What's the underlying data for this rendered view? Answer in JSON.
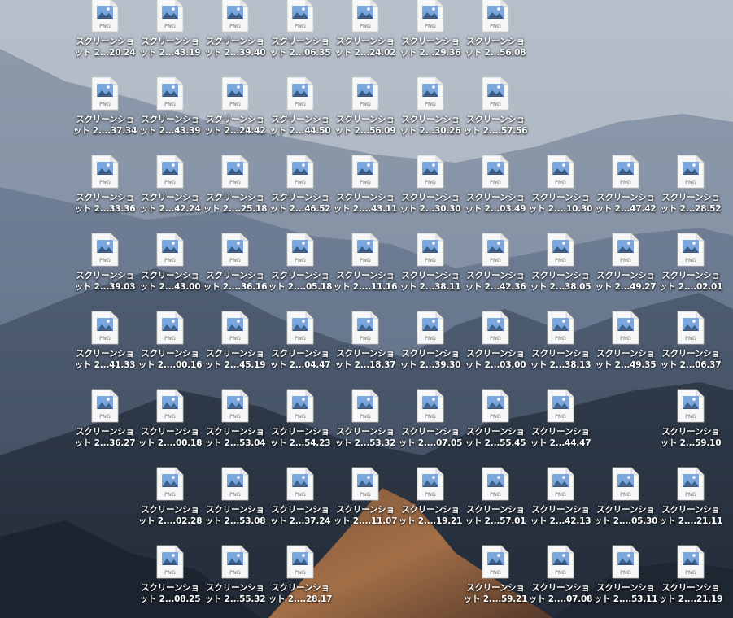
{
  "desktop": {
    "icon_type_label": "PNG",
    "accent": "#7aa6e0",
    "files": [
      {
        "line1": "スクリーンショ",
        "line2": "ット 2...20.24",
        "col": 0,
        "row": 0
      },
      {
        "line1": "スクリーンショ",
        "line2": "ット 2...43.19",
        "col": 1,
        "row": 0
      },
      {
        "line1": "スクリーンショ",
        "line2": "ット 2...39.40",
        "col": 2,
        "row": 0
      },
      {
        "line1": "スクリーンショ",
        "line2": "ット 2...06.35",
        "col": 3,
        "row": 0
      },
      {
        "line1": "スクリーンショ",
        "line2": "ット 2...24.02",
        "col": 4,
        "row": 0
      },
      {
        "line1": "スクリーンショ",
        "line2": "ット 2...29.36",
        "col": 5,
        "row": 0
      },
      {
        "line1": "スクリーンショ",
        "line2": "ット 2...56.08",
        "col": 6,
        "row": 0
      },
      {
        "line1": "スクリーンショ",
        "line2": "ット 2....37.34",
        "col": 0,
        "row": 1
      },
      {
        "line1": "スクリーンショ",
        "line2": "ット 2...43.39",
        "col": 1,
        "row": 1
      },
      {
        "line1": "スクリーンショ",
        "line2": "ット 2...24.42",
        "col": 2,
        "row": 1
      },
      {
        "line1": "スクリーンショ",
        "line2": "ット 2...44.50",
        "col": 3,
        "row": 1
      },
      {
        "line1": "スクリーンショ",
        "line2": "ット 2...56.09",
        "col": 4,
        "row": 1
      },
      {
        "line1": "スクリーンショ",
        "line2": "ット 2...30.26",
        "col": 5,
        "row": 1
      },
      {
        "line1": "スクリーンショ",
        "line2": "ット 2....57.56",
        "col": 6,
        "row": 1
      },
      {
        "line1": "スクリーンショ",
        "line2": "ット 2...33.36",
        "col": 0,
        "row": 2
      },
      {
        "line1": "スクリーンショ",
        "line2": "ット 2...42.24",
        "col": 1,
        "row": 2
      },
      {
        "line1": "スクリーンショ",
        "line2": "ット 2....25.18",
        "col": 2,
        "row": 2
      },
      {
        "line1": "スクリーンショ",
        "line2": "ット 2...46.52",
        "col": 3,
        "row": 2
      },
      {
        "line1": "スクリーンショ",
        "line2": "ット 2....43.11",
        "col": 4,
        "row": 2
      },
      {
        "line1": "スクリーンショ",
        "line2": "ット 2...30.30",
        "col": 5,
        "row": 2
      },
      {
        "line1": "スクリーンショ",
        "line2": "ット 2...03.49",
        "col": 6,
        "row": 2
      },
      {
        "line1": "スクリーンショ",
        "line2": "ット 2....10.30",
        "col": 7,
        "row": 2
      },
      {
        "line1": "スクリーンショ",
        "line2": "ット 2...47.42",
        "col": 8,
        "row": 2
      },
      {
        "line1": "スクリーンショ",
        "line2": "ット 2...28.52",
        "col": 9,
        "row": 2
      },
      {
        "line1": "スクリーンショ",
        "line2": "ット 2...39.03",
        "col": 0,
        "row": 3
      },
      {
        "line1": "スクリーンショ",
        "line2": "ット 2...43.00",
        "col": 1,
        "row": 3
      },
      {
        "line1": "スクリーンショ",
        "line2": "ット 2....36.16",
        "col": 2,
        "row": 3
      },
      {
        "line1": "スクリーンショ",
        "line2": "ット 2....05.18",
        "col": 3,
        "row": 3
      },
      {
        "line1": "スクリーンショ",
        "line2": "ット 2....11.16",
        "col": 4,
        "row": 3
      },
      {
        "line1": "スクリーンショ",
        "line2": "ット 2...38.11",
        "col": 5,
        "row": 3
      },
      {
        "line1": "スクリーンショ",
        "line2": "ット 2...42.36",
        "col": 6,
        "row": 3
      },
      {
        "line1": "スクリーンショ",
        "line2": "ット 2...38.05",
        "col": 7,
        "row": 3
      },
      {
        "line1": "スクリーンショ",
        "line2": "ット 2...49.27",
        "col": 8,
        "row": 3
      },
      {
        "line1": "スクリーンショ",
        "line2": "ット 2....02.01",
        "col": 9,
        "row": 3
      },
      {
        "line1": "スクリーンショ",
        "line2": "ット 2...41.33",
        "col": 0,
        "row": 4
      },
      {
        "line1": "スクリーンショ",
        "line2": "ット 2....00.16",
        "col": 1,
        "row": 4
      },
      {
        "line1": "スクリーンショ",
        "line2": "ット 2...45.19",
        "col": 2,
        "row": 4
      },
      {
        "line1": "スクリーンショ",
        "line2": "ット 2...04.47",
        "col": 3,
        "row": 4
      },
      {
        "line1": "スクリーンショ",
        "line2": "ット 2...18.37",
        "col": 4,
        "row": 4
      },
      {
        "line1": "スクリーンショ",
        "line2": "ット 2...39.30",
        "col": 5,
        "row": 4
      },
      {
        "line1": "スクリーンショ",
        "line2": "ット 2...03.00",
        "col": 6,
        "row": 4
      },
      {
        "line1": "スクリーンショ",
        "line2": "ット 2...38.13",
        "col": 7,
        "row": 4
      },
      {
        "line1": "スクリーンショ",
        "line2": "ット 2...49.35",
        "col": 8,
        "row": 4
      },
      {
        "line1": "スクリーンショ",
        "line2": "ット 2...06.37",
        "col": 9,
        "row": 4
      },
      {
        "line1": "スクリーンショ",
        "line2": "ット 2...36.27",
        "col": 0,
        "row": 5
      },
      {
        "line1": "スクリーンショ",
        "line2": "ット 2....00.18",
        "col": 1,
        "row": 5
      },
      {
        "line1": "スクリーンショ",
        "line2": "ット 2...53.04",
        "col": 2,
        "row": 5
      },
      {
        "line1": "スクリーンショ",
        "line2": "ット 2...54.23",
        "col": 3,
        "row": 5
      },
      {
        "line1": "スクリーンショ",
        "line2": "ット 2...53.32",
        "col": 4,
        "row": 5
      },
      {
        "line1": "スクリーンショ",
        "line2": "ット 2....07.05",
        "col": 5,
        "row": 5
      },
      {
        "line1": "スクリーンショ",
        "line2": "ット 2...55.45",
        "col": 6,
        "row": 5
      },
      {
        "line1": "スクリーンショ",
        "line2": "ット 2...44.47",
        "col": 7,
        "row": 5
      },
      {
        "line1": "スクリーンショ",
        "line2": "ット 2...59.10",
        "col": 9,
        "row": 5
      },
      {
        "line1": "スクリーンショ",
        "line2": "ット 2....02.28",
        "col": 1,
        "row": 6
      },
      {
        "line1": "スクリーンショ",
        "line2": "ット 2...53.08",
        "col": 2,
        "row": 6
      },
      {
        "line1": "スクリーンショ",
        "line2": "ット 2...37.24",
        "col": 3,
        "row": 6
      },
      {
        "line1": "スクリーンショ",
        "line2": "ット 2....11.07",
        "col": 4,
        "row": 6
      },
      {
        "line1": "スクリーンショ",
        "line2": "ット 2....19.21",
        "col": 5,
        "row": 6
      },
      {
        "line1": "スクリーンショ",
        "line2": "ット 2...57.01",
        "col": 6,
        "row": 6
      },
      {
        "line1": "スクリーンショ",
        "line2": "ット 2...42.13",
        "col": 7,
        "row": 6
      },
      {
        "line1": "スクリーンショ",
        "line2": "ット 2....05.30",
        "col": 8,
        "row": 6
      },
      {
        "line1": "スクリーンショ",
        "line2": "ット 2....21.11",
        "col": 9,
        "row": 6
      },
      {
        "line1": "スクリーンショ",
        "line2": "ット 2...08.25",
        "col": 1,
        "row": 7
      },
      {
        "line1": "スクリーンショ",
        "line2": "ット 2...55.32",
        "col": 2,
        "row": 7
      },
      {
        "line1": "スクリーンショ",
        "line2": "ット 2....28.17",
        "col": 3,
        "row": 7
      },
      {
        "line1": "スクリーンショ",
        "line2": "ット 2....59.21",
        "col": 6,
        "row": 7
      },
      {
        "line1": "スクリーンショ",
        "line2": "ット 2....07.08",
        "col": 7,
        "row": 7
      },
      {
        "line1": "スクリーンショ",
        "line2": "ット 2....53.11",
        "col": 8,
        "row": 7
      },
      {
        "line1": "スクリーンショ",
        "line2": "ット 2....21.19",
        "col": 9,
        "row": 7
      }
    ]
  }
}
